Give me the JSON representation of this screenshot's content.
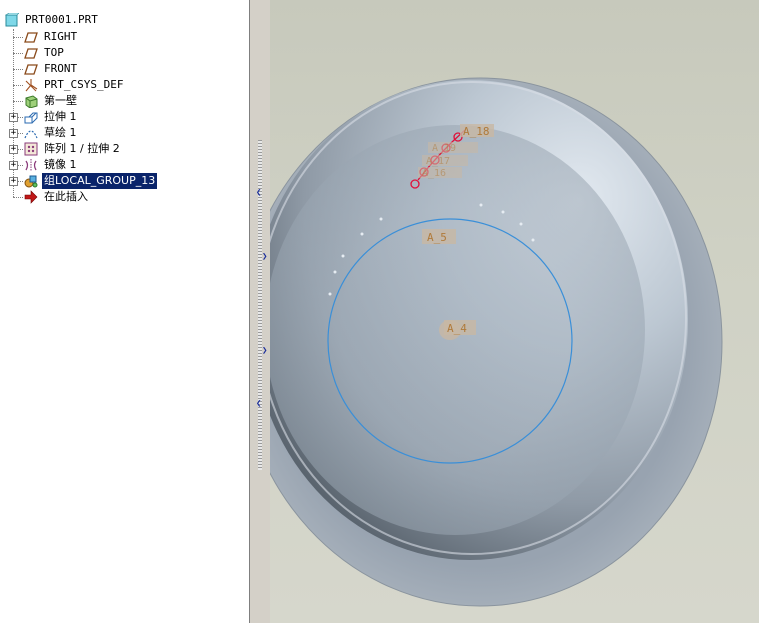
{
  "model_tree": {
    "root": "PRT0001.PRT",
    "items": [
      {
        "label": "RIGHT",
        "icon": "datum-plane-icon",
        "expandable": false
      },
      {
        "label": "TOP",
        "icon": "datum-plane-icon",
        "expandable": false
      },
      {
        "label": "FRONT",
        "icon": "datum-plane-icon",
        "expandable": false
      },
      {
        "label": "PRT_CSYS_DEF",
        "icon": "coordinate-system-icon",
        "expandable": false
      },
      {
        "label": "第一壁",
        "icon": "sheetmetal-wall-icon",
        "expandable": false
      },
      {
        "label": "拉伸 1",
        "icon": "extrude-icon",
        "expandable": true
      },
      {
        "label": "草绘 1",
        "icon": "sketch-icon",
        "expandable": true
      },
      {
        "label": "阵列 1 / 拉伸 2",
        "icon": "pattern-icon",
        "expandable": true
      },
      {
        "label": "镜像 1",
        "icon": "mirror-icon",
        "expandable": true
      },
      {
        "label": "组LOCAL_GROUP_13",
        "icon": "group-icon",
        "expandable": true,
        "selected": true
      },
      {
        "label": "在此插入",
        "icon": "insert-here-arrow-icon",
        "expandable": false
      }
    ]
  },
  "graphics": {
    "axis_labels": [
      "A_18",
      "A_5",
      "A_4"
    ],
    "faded_labels": [
      "A_19",
      "A_17",
      "A_16"
    ]
  },
  "colors": {
    "selection": "#0a246a",
    "sketch_circle": "#3a8fd8",
    "pattern_holes": "#e0103a",
    "part_surface": "#a9b2bd"
  }
}
